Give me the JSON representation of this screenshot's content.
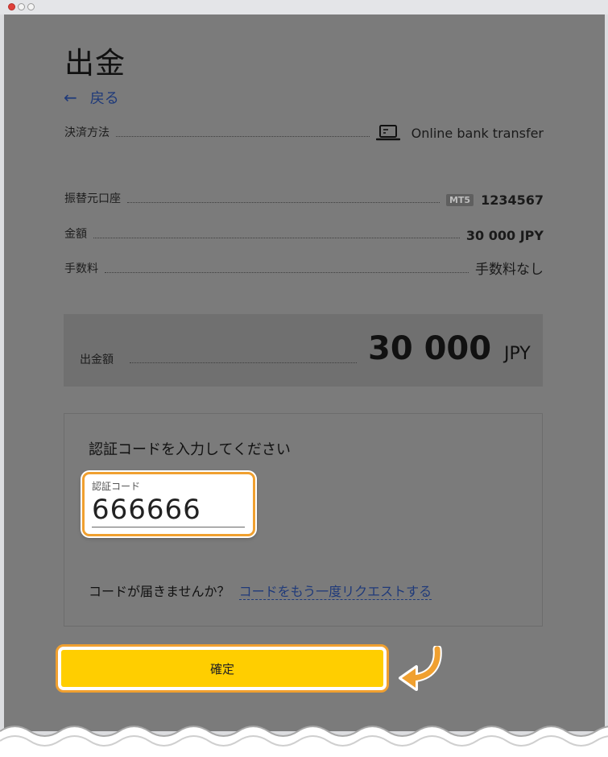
{
  "page": {
    "title": "出金",
    "back_label": "戻る"
  },
  "details": {
    "payment_method_label": "決済方法",
    "payment_method_value": "Online bank transfer",
    "source_account_label": "振替元口座",
    "account_badge": "MT5",
    "account_number": "1234567",
    "amount_label": "金額",
    "amount_value": "30 000 JPY",
    "fee_label": "手数料",
    "fee_value": "手数料なし"
  },
  "withdrawal_total": {
    "label": "出金額",
    "value": "30 000",
    "currency": "JPY"
  },
  "verification": {
    "title": "認証コードを入力してください",
    "field_label": "認証コード",
    "field_value": "666666",
    "no_code_text": "コードが届きませんか？",
    "resend_link": "コードをもう一度リクエストする"
  },
  "actions": {
    "confirm_label": "確定"
  },
  "colors": {
    "overlay": "#7b7b7b",
    "confirm_button": "#ffce00",
    "highlight_border": "#f0a030",
    "link": "#1f3a7a"
  }
}
